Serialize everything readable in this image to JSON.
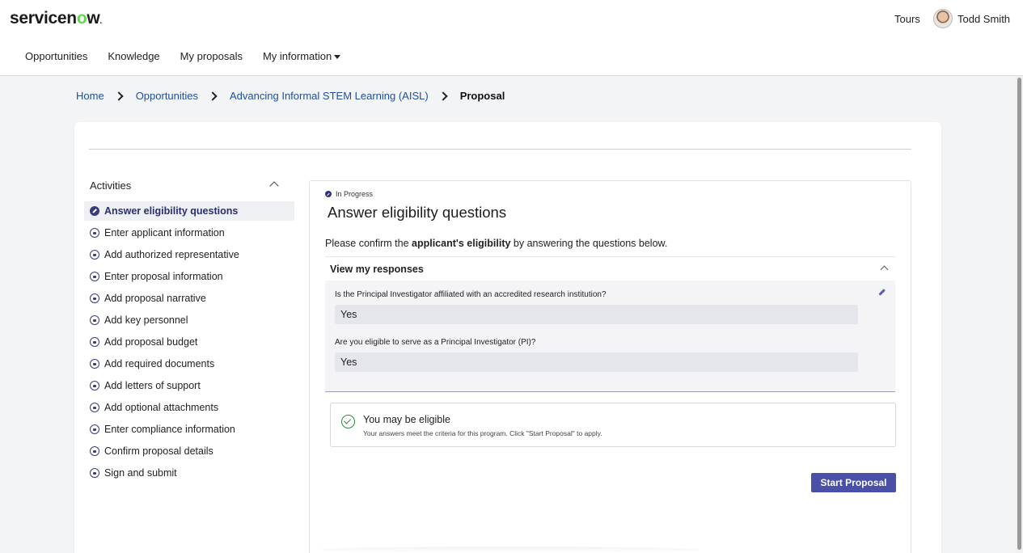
{
  "header": {
    "logo_prefix": "servicen",
    "logo_o": "o",
    "logo_suffix": "w",
    "logo_dot": ".",
    "tours_label": "Tours",
    "user_name": "Todd Smith"
  },
  "nav": {
    "items": [
      "Opportunities",
      "Knowledge",
      "My proposals",
      "My information"
    ]
  },
  "breadcrumb": {
    "home": "Home",
    "opportunities": "Opportunities",
    "program": "Advancing Informal STEM Learning (AISL)",
    "current": "Proposal"
  },
  "sidebar": {
    "heading": "Activities",
    "steps": [
      "Answer eligibility questions",
      "Enter applicant information",
      "Add authorized representative",
      "Enter proposal information",
      "Add proposal narrative",
      "Add key personnel",
      "Add proposal budget",
      "Add required documents",
      "Add letters of support",
      "Add optional attachments",
      "Enter compliance information",
      "Confirm proposal details",
      "Sign and submit"
    ]
  },
  "main": {
    "status": "In Progress",
    "title": "Answer eligibility questions",
    "intro_before": "Please confirm the ",
    "intro_bold": "applicant's eligibility",
    "intro_after": " by answering the questions below.",
    "responses_heading": "View my responses",
    "questions": [
      {
        "q": "Is the Principal Investigator affiliated with an accredited research institution?",
        "a": "Yes"
      },
      {
        "q": "Are you eligible to serve as a Principal Investigator (PI)?",
        "a": "Yes"
      }
    ],
    "eligibility_title": "You may be eligible",
    "eligibility_sub": "Your answers meet the criteria for this program. Click \"Start Proposal\" to apply.",
    "start_button": "Start Proposal"
  }
}
